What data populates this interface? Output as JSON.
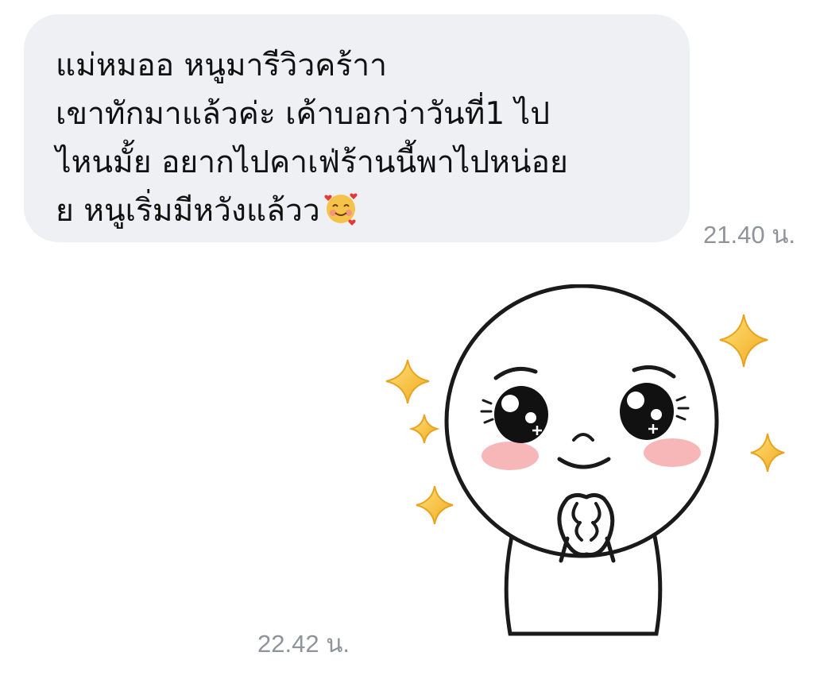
{
  "chat": {
    "messages": [
      {
        "type": "text",
        "lines": [
          "แม่หมออ หนูมารีวิวคร้าา",
          "เขาทักมาแล้วค่ะ เค้าบอกว่าวันที่1 ไป",
          "ไหนมั้ย อยากไปคาเฟ่ร้านนี้พาไปหน่อย",
          "ย หนูเริ่มมีหวังแล้วว"
        ],
        "emoji": "smiling-face-with-hearts",
        "time": "21.40 น."
      },
      {
        "type": "sticker",
        "sticker": "pleading-face-sparkles",
        "time": "22.42 น."
      }
    ]
  },
  "colors": {
    "bubble_bg": "#eef0f3",
    "text": "#111111",
    "timestamp": "#8f949a",
    "sparkle": "#f3c03a",
    "blush": "#f7b6b8"
  }
}
